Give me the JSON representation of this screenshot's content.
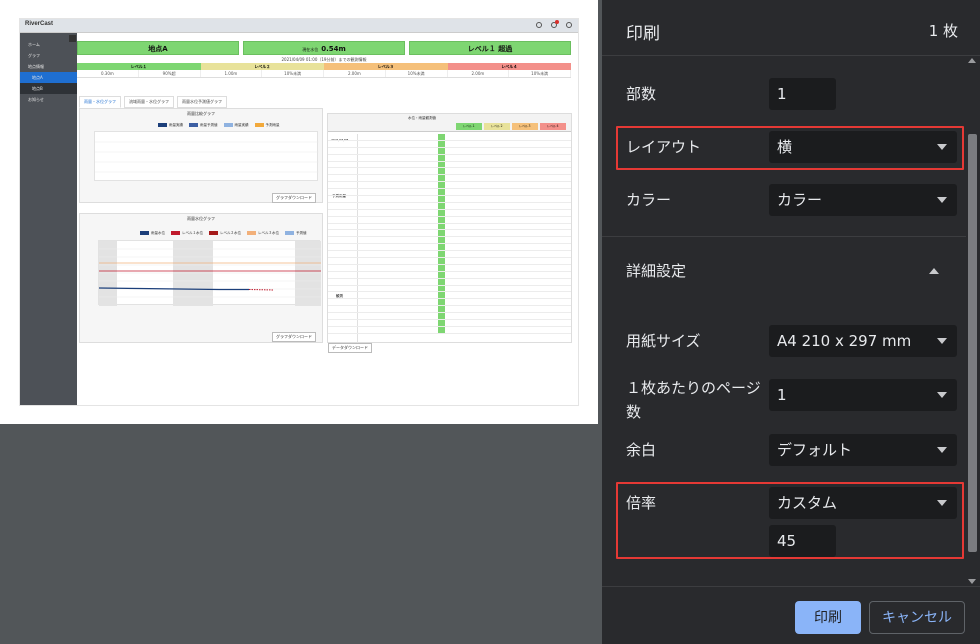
{
  "dialog": {
    "title": "印刷",
    "page_count": "1 枚"
  },
  "settings": {
    "copies": {
      "label": "部数",
      "value": "1"
    },
    "layout": {
      "label": "レイアウト",
      "value": "横"
    },
    "color": {
      "label": "カラー",
      "value": "カラー"
    },
    "advanced_label": "詳細設定",
    "paper_size": {
      "label": "用紙サイズ",
      "value": "A4 210 x 297 mm"
    },
    "pages_per_sheet": {
      "label": "１枚あたりのページ数",
      "value": "1"
    },
    "margins": {
      "label": "余白",
      "value": "デフォルト"
    },
    "scale": {
      "label": "倍率",
      "value": "カスタム",
      "custom_value": "45"
    }
  },
  "buttons": {
    "print": "印刷",
    "cancel": "キャンセル"
  },
  "highlight_color": "#e53935",
  "preview": {
    "app_name": "RiverCast",
    "sidebar": [
      "ホーム",
      "グラフ",
      "地点情報",
      "地点A",
      "地点B",
      "お知らせ"
    ],
    "status": {
      "location": "地点A",
      "level_prefix": "現在水位",
      "level_value": "0.54m",
      "alert": "レベル１ 超過"
    },
    "update_note": "2021/04/09 01:00（19分前）までの観測情報",
    "level_headers": [
      "レベル１",
      "レベル２",
      "レベル３",
      "レベル４"
    ],
    "level_colors": [
      "#7ed672",
      "#e8e29a",
      "#f5c07a",
      "#f3908a"
    ],
    "level_values": [
      "0.30m",
      "90%超",
      "1.00m",
      "10%未満",
      "2.00m",
      "10%未満",
      "2.00m",
      "10%未満"
    ],
    "tabs": [
      "雨量・水位グラフ",
      "流域雨量・水位グラフ",
      "雨量水位予測値グラフ"
    ],
    "rain_chart_title": "雨量比較グラフ",
    "rain_legend": [
      "雨量実績",
      "雨量予測値",
      "雨量実績",
      "予測雨量"
    ],
    "water_chart_title": "雨量水位グラフ",
    "water_legend": [
      "雨量水位",
      "レベル１水位",
      "レベル２水位",
      "レベル３水位",
      "予測値"
    ],
    "download_label": "グラフダウンロード",
    "data_download_label": "データダウンロード",
    "table_title": "水位・雨量観測値",
    "table_date_1": "2021/04/08",
    "table_section_1": "予測雨量",
    "table_section_2": "観測"
  }
}
